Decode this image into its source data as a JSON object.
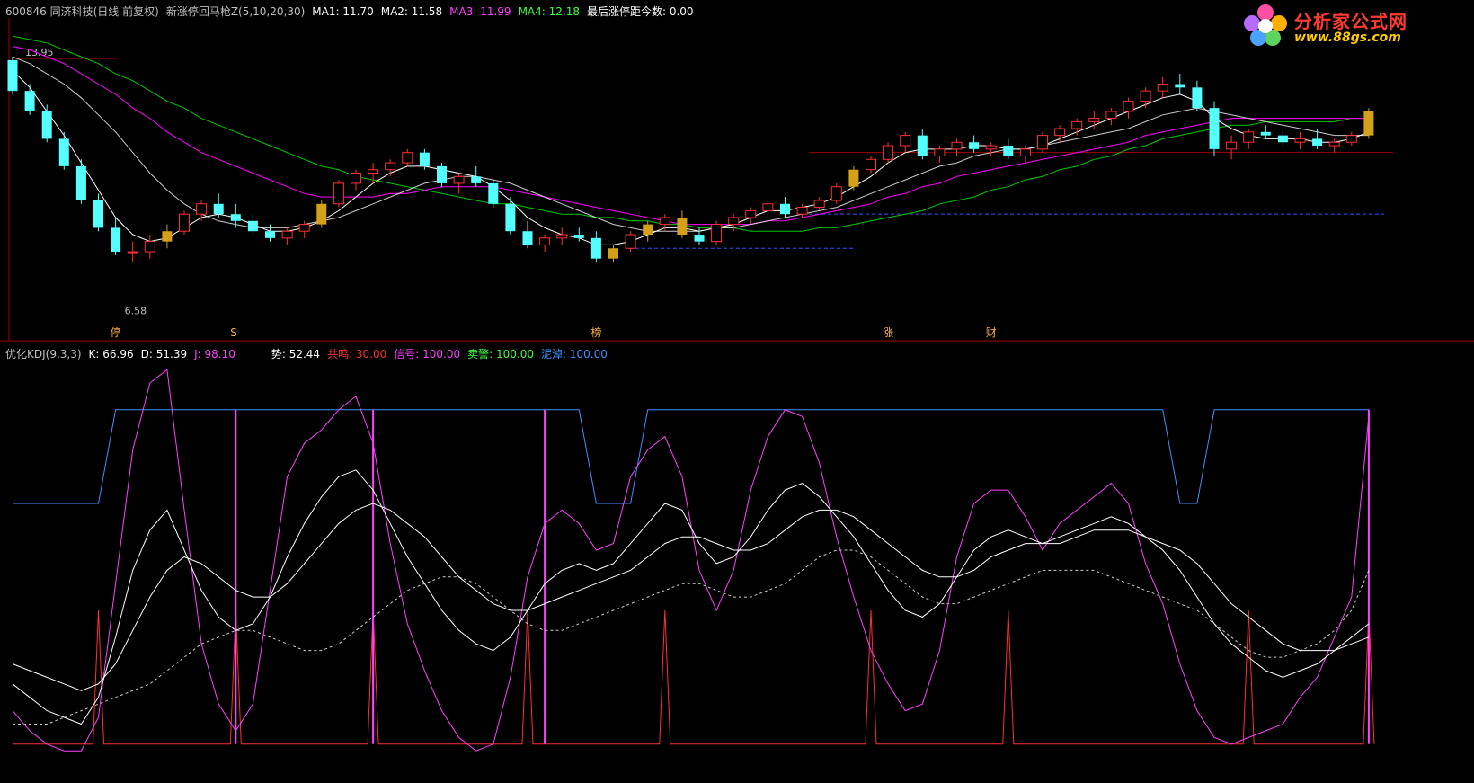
{
  "header": {
    "stock": "600846 同济科技(日线 前复权)",
    "indicator": "新涨停回马枪Z(5,10,20,30)",
    "ma1": "MA1: 11.70",
    "ma2": "MA2: 11.58",
    "ma3": "MA3: 11.99",
    "ma4": "MA4: 12.18",
    "last_limit": "最后涨停距今数: 0.00"
  },
  "kdj_header": {
    "name": "优化KDJ(9,3,3)",
    "k": "K: 66.96",
    "d": "D: 51.39",
    "j": "J: 98.10",
    "shi": "势: 52.44",
    "gongming": "共鸣: 30.00",
    "xinhao": "信号: 100.00",
    "maijing": "卖警: 100.00",
    "nizhuo": "泥淖: 100.00"
  },
  "logo": {
    "title": "分析家公式网",
    "url": "www.88gs.com"
  },
  "colors": {
    "up": "#ff3030",
    "down": "#54ffff",
    "gold": "#d4a017",
    "ma1": "#ffffff",
    "ma2": "#ffffff",
    "ma3": "#ff00ff",
    "ma4": "#00c800",
    "k": "#ffffff",
    "d": "#ffffff",
    "j": "#ff40ff",
    "shi": "#ffffff",
    "gongming": "#ff3030",
    "xinhao": "#ff40ff",
    "maijing": "#00ff00",
    "nizhuo": "#4090ff"
  },
  "chart_data": [
    {
      "type": "candlestick",
      "price_labels": {
        "high": "13.95",
        "low": "6.58"
      },
      "bottom_markers": [
        {
          "i": 6,
          "text": "停"
        },
        {
          "i": 13,
          "text": "S"
        },
        {
          "i": 34,
          "text": "榜"
        },
        {
          "i": 51,
          "text": "涨"
        },
        {
          "i": 57,
          "text": "财"
        }
      ],
      "ohlc": [
        [
          13.9,
          14.0,
          12.9,
          13.0
        ],
        [
          13.0,
          13.2,
          12.3,
          12.4
        ],
        [
          12.4,
          12.6,
          11.5,
          11.6
        ],
        [
          11.6,
          11.8,
          10.7,
          10.8
        ],
        [
          10.8,
          11.0,
          9.7,
          9.8
        ],
        [
          9.8,
          10.0,
          8.9,
          9.0
        ],
        [
          9.0,
          9.3,
          8.2,
          8.3
        ],
        [
          8.3,
          8.6,
          8.0,
          8.3
        ],
        [
          8.3,
          8.8,
          8.1,
          8.6
        ],
        [
          8.6,
          9.1,
          8.4,
          8.9
        ],
        [
          8.9,
          9.5,
          8.8,
          9.4
        ],
        [
          9.4,
          9.8,
          9.2,
          9.7
        ],
        [
          9.7,
          10.0,
          9.3,
          9.4
        ],
        [
          9.4,
          9.7,
          9.0,
          9.2
        ],
        [
          9.2,
          9.4,
          8.8,
          8.9
        ],
        [
          8.9,
          9.1,
          8.6,
          8.7
        ],
        [
          8.7,
          9.0,
          8.5,
          8.9
        ],
        [
          8.9,
          9.2,
          8.7,
          9.1
        ],
        [
          9.1,
          9.8,
          9.0,
          9.7
        ],
        [
          9.7,
          10.4,
          9.6,
          10.3
        ],
        [
          10.3,
          10.7,
          10.1,
          10.6
        ],
        [
          10.6,
          10.9,
          10.3,
          10.7
        ],
        [
          10.7,
          11.0,
          10.5,
          10.9
        ],
        [
          10.9,
          11.3,
          10.8,
          11.2
        ],
        [
          11.2,
          11.3,
          10.7,
          10.8
        ],
        [
          10.8,
          10.9,
          10.2,
          10.3
        ],
        [
          10.3,
          10.6,
          10.0,
          10.5
        ],
        [
          10.5,
          10.8,
          10.2,
          10.3
        ],
        [
          10.3,
          10.4,
          9.6,
          9.7
        ],
        [
          9.7,
          9.9,
          8.8,
          8.9
        ],
        [
          8.9,
          9.2,
          8.4,
          8.5
        ],
        [
          8.5,
          8.8,
          8.3,
          8.7
        ],
        [
          8.7,
          9.0,
          8.5,
          8.8
        ],
        [
          8.8,
          9.0,
          8.6,
          8.7
        ],
        [
          8.7,
          8.9,
          8.0,
          8.1
        ],
        [
          8.1,
          8.5,
          8.0,
          8.4
        ],
        [
          8.4,
          8.9,
          8.3,
          8.8
        ],
        [
          8.8,
          9.2,
          8.6,
          9.1
        ],
        [
          9.1,
          9.4,
          8.9,
          9.3
        ],
        [
          9.3,
          9.5,
          8.7,
          8.8
        ],
        [
          8.8,
          9.0,
          8.5,
          8.6
        ],
        [
          8.6,
          9.2,
          8.5,
          9.1
        ],
        [
          9.1,
          9.4,
          8.9,
          9.3
        ],
        [
          9.3,
          9.6,
          9.1,
          9.5
        ],
        [
          9.5,
          9.8,
          9.3,
          9.7
        ],
        [
          9.7,
          9.9,
          9.3,
          9.4
        ],
        [
          9.4,
          9.7,
          9.3,
          9.6
        ],
        [
          9.6,
          9.9,
          9.5,
          9.8
        ],
        [
          9.8,
          10.3,
          9.7,
          10.2
        ],
        [
          10.2,
          10.8,
          10.1,
          10.7
        ],
        [
          10.7,
          11.1,
          10.6,
          11.0
        ],
        [
          11.0,
          11.5,
          10.9,
          11.4
        ],
        [
          11.4,
          11.8,
          11.2,
          11.7
        ],
        [
          11.7,
          11.9,
          11.0,
          11.1
        ],
        [
          11.1,
          11.4,
          10.9,
          11.3
        ],
        [
          11.3,
          11.6,
          11.1,
          11.5
        ],
        [
          11.5,
          11.7,
          11.2,
          11.3
        ],
        [
          11.3,
          11.5,
          11.1,
          11.4
        ],
        [
          11.4,
          11.6,
          11.0,
          11.1
        ],
        [
          11.1,
          11.4,
          10.9,
          11.3
        ],
        [
          11.3,
          11.8,
          11.2,
          11.7
        ],
        [
          11.7,
          12.0,
          11.5,
          11.9
        ],
        [
          11.9,
          12.2,
          11.7,
          12.1
        ],
        [
          12.1,
          12.4,
          11.9,
          12.2
        ],
        [
          12.2,
          12.5,
          12.0,
          12.4
        ],
        [
          12.4,
          12.8,
          12.2,
          12.7
        ],
        [
          12.7,
          13.1,
          12.5,
          13.0
        ],
        [
          13.0,
          13.4,
          12.8,
          13.2
        ],
        [
          13.2,
          13.5,
          12.9,
          13.1
        ],
        [
          13.1,
          13.3,
          12.4,
          12.5
        ],
        [
          12.5,
          12.7,
          11.1,
          11.3
        ],
        [
          11.3,
          11.7,
          11.0,
          11.5
        ],
        [
          11.5,
          11.9,
          11.3,
          11.8
        ],
        [
          11.8,
          12.0,
          11.6,
          11.7
        ],
        [
          11.7,
          11.9,
          11.4,
          11.5
        ],
        [
          11.5,
          11.8,
          11.3,
          11.6
        ],
        [
          11.6,
          11.9,
          11.3,
          11.4
        ],
        [
          11.4,
          11.6,
          11.2,
          11.5
        ],
        [
          11.5,
          11.8,
          11.4,
          11.7
        ],
        [
          11.7,
          12.5,
          11.6,
          12.4
        ]
      ],
      "ma1": [
        13.6,
        13.1,
        12.4,
        11.7,
        10.9,
        10.1,
        9.3,
        8.8,
        8.6,
        8.7,
        9.0,
        9.3,
        9.4,
        9.3,
        9.1,
        8.9,
        8.9,
        9.0,
        9.2,
        9.5,
        9.9,
        10.3,
        10.6,
        10.8,
        10.8,
        10.7,
        10.6,
        10.5,
        10.2,
        9.8,
        9.3,
        9.0,
        8.8,
        8.7,
        8.5,
        8.5,
        8.6,
        8.8,
        9.0,
        9.0,
        8.9,
        9.0,
        9.1,
        9.3,
        9.5,
        9.5,
        9.6,
        9.7,
        9.9,
        10.2,
        10.5,
        10.9,
        11.2,
        11.3,
        11.3,
        11.3,
        11.4,
        11.4,
        11.3,
        11.3,
        11.4,
        11.6,
        11.8,
        12.0,
        12.2,
        12.4,
        12.6,
        12.8,
        12.9,
        12.7,
        12.2,
        11.9,
        11.7,
        11.6,
        11.6,
        11.6,
        11.5,
        11.5,
        11.6,
        11.8
      ],
      "ma2": [
        14.0,
        13.8,
        13.5,
        13.2,
        12.8,
        12.3,
        11.8,
        11.2,
        10.6,
        10.1,
        9.7,
        9.4,
        9.2,
        9.1,
        9.0,
        9.0,
        9.0,
        9.1,
        9.2,
        9.3,
        9.5,
        9.7,
        9.9,
        10.1,
        10.3,
        10.4,
        10.5,
        10.5,
        10.4,
        10.3,
        10.1,
        9.9,
        9.7,
        9.5,
        9.3,
        9.1,
        9.0,
        8.9,
        8.9,
        8.9,
        8.9,
        9.0,
        9.0,
        9.1,
        9.2,
        9.3,
        9.4,
        9.5,
        9.6,
        9.8,
        10.0,
        10.2,
        10.4,
        10.6,
        10.8,
        10.9,
        11.1,
        11.2,
        11.3,
        11.3,
        11.4,
        11.5,
        11.6,
        11.7,
        11.8,
        11.9,
        12.1,
        12.3,
        12.4,
        12.5,
        12.4,
        12.3,
        12.2,
        12.1,
        12.0,
        11.9,
        11.8,
        11.7,
        11.7,
        11.7
      ],
      "ma3": [
        14.3,
        14.2,
        14.0,
        13.8,
        13.5,
        13.2,
        12.9,
        12.5,
        12.2,
        11.8,
        11.5,
        11.2,
        11.0,
        10.8,
        10.6,
        10.4,
        10.2,
        10.0,
        9.9,
        9.9,
        9.9,
        9.9,
        10.0,
        10.0,
        10.1,
        10.2,
        10.2,
        10.2,
        10.2,
        10.1,
        10.0,
        9.9,
        9.8,
        9.7,
        9.6,
        9.5,
        9.4,
        9.3,
        9.2,
        9.1,
        9.1,
        9.1,
        9.1,
        9.1,
        9.2,
        9.2,
        9.3,
        9.4,
        9.5,
        9.6,
        9.7,
        9.9,
        10.0,
        10.2,
        10.3,
        10.5,
        10.6,
        10.7,
        10.8,
        10.9,
        11.0,
        11.1,
        11.2,
        11.3,
        11.4,
        11.5,
        11.7,
        11.8,
        11.9,
        12.0,
        12.1,
        12.2,
        12.2,
        12.2,
        12.2,
        12.2,
        12.2,
        12.2,
        12.2,
        12.2
      ],
      "ma4": [
        14.6,
        14.5,
        14.4,
        14.2,
        14.0,
        13.8,
        13.5,
        13.3,
        13.0,
        12.7,
        12.5,
        12.2,
        12.0,
        11.8,
        11.6,
        11.4,
        11.2,
        11.0,
        10.8,
        10.7,
        10.5,
        10.4,
        10.3,
        10.2,
        10.1,
        10.0,
        9.9,
        9.8,
        9.7,
        9.7,
        9.6,
        9.5,
        9.4,
        9.4,
        9.3,
        9.3,
        9.2,
        9.2,
        9.1,
        9.1,
        9.0,
        9.0,
        9.0,
        8.9,
        8.9,
        8.9,
        8.9,
        9.0,
        9.0,
        9.1,
        9.2,
        9.3,
        9.4,
        9.5,
        9.7,
        9.8,
        9.9,
        10.1,
        10.2,
        10.4,
        10.5,
        10.7,
        10.8,
        11.0,
        11.1,
        11.3,
        11.4,
        11.6,
        11.7,
        11.8,
        11.9,
        12.0,
        12.0,
        12.1,
        12.1,
        12.1,
        12.1,
        12.1,
        12.2,
        12.2
      ]
    },
    {
      "type": "line",
      "ylim": [
        -10,
        115
      ],
      "k": [
        18,
        14,
        10,
        8,
        6,
        14,
        32,
        52,
        64,
        70,
        58,
        46,
        38,
        34,
        36,
        44,
        56,
        66,
        74,
        80,
        82,
        76,
        66,
        56,
        48,
        40,
        34,
        30,
        28,
        32,
        40,
        48,
        52,
        54,
        52,
        54,
        60,
        66,
        72,
        70,
        60,
        54,
        56,
        62,
        70,
        76,
        78,
        74,
        68,
        62,
        54,
        46,
        40,
        38,
        42,
        50,
        58,
        62,
        64,
        62,
        60,
        62,
        64,
        66,
        68,
        66,
        62,
        58,
        52,
        44,
        36,
        30,
        26,
        22,
        20,
        22,
        24,
        28,
        32,
        36
      ],
      "d": [
        24,
        22,
        20,
        18,
        16,
        18,
        24,
        34,
        44,
        52,
        56,
        54,
        50,
        46,
        44,
        44,
        48,
        54,
        60,
        66,
        70,
        72,
        70,
        66,
        62,
        56,
        50,
        46,
        42,
        40,
        40,
        42,
        44,
        46,
        48,
        50,
        52,
        56,
        60,
        62,
        62,
        60,
        58,
        58,
        60,
        64,
        68,
        70,
        70,
        68,
        64,
        60,
        56,
        52,
        50,
        50,
        52,
        56,
        58,
        60,
        60,
        60,
        62,
        64,
        64,
        64,
        62,
        60,
        58,
        54,
        48,
        42,
        38,
        34,
        30,
        28,
        28,
        28,
        30,
        32
      ],
      "j": [
        10,
        4,
        0,
        -2,
        -4,
        8,
        48,
        88,
        108,
        112,
        70,
        30,
        12,
        4,
        12,
        46,
        80,
        90,
        94,
        100,
        104,
        90,
        60,
        36,
        22,
        10,
        2,
        -2,
        0,
        20,
        50,
        66,
        70,
        66,
        58,
        60,
        80,
        88,
        92,
        80,
        52,
        40,
        52,
        76,
        92,
        100,
        98,
        84,
        62,
        44,
        28,
        18,
        10,
        12,
        28,
        56,
        72,
        76,
        76,
        68,
        58,
        66,
        70,
        74,
        78,
        72,
        54,
        42,
        24,
        10,
        2,
        0,
        2,
        4,
        6,
        14,
        20,
        32,
        44,
        98
      ],
      "shi": [
        6,
        6,
        6,
        8,
        10,
        12,
        14,
        16,
        18,
        22,
        26,
        30,
        32,
        34,
        34,
        32,
        30,
        28,
        28,
        30,
        34,
        38,
        42,
        46,
        48,
        50,
        50,
        48,
        44,
        40,
        36,
        34,
        34,
        36,
        38,
        40,
        42,
        44,
        46,
        48,
        48,
        46,
        44,
        44,
        46,
        48,
        52,
        56,
        58,
        58,
        56,
        52,
        48,
        44,
        42,
        42,
        44,
        46,
        48,
        50,
        52,
        52,
        52,
        52,
        50,
        48,
        46,
        44,
        42,
        40,
        36,
        32,
        28,
        26,
        26,
        28,
        30,
        34,
        40,
        52
      ],
      "signal_spikes": [
        5,
        13,
        21,
        30,
        38,
        50,
        58,
        72,
        79
      ],
      "xinhao_bars": [
        13,
        21,
        31,
        79
      ]
    }
  ]
}
